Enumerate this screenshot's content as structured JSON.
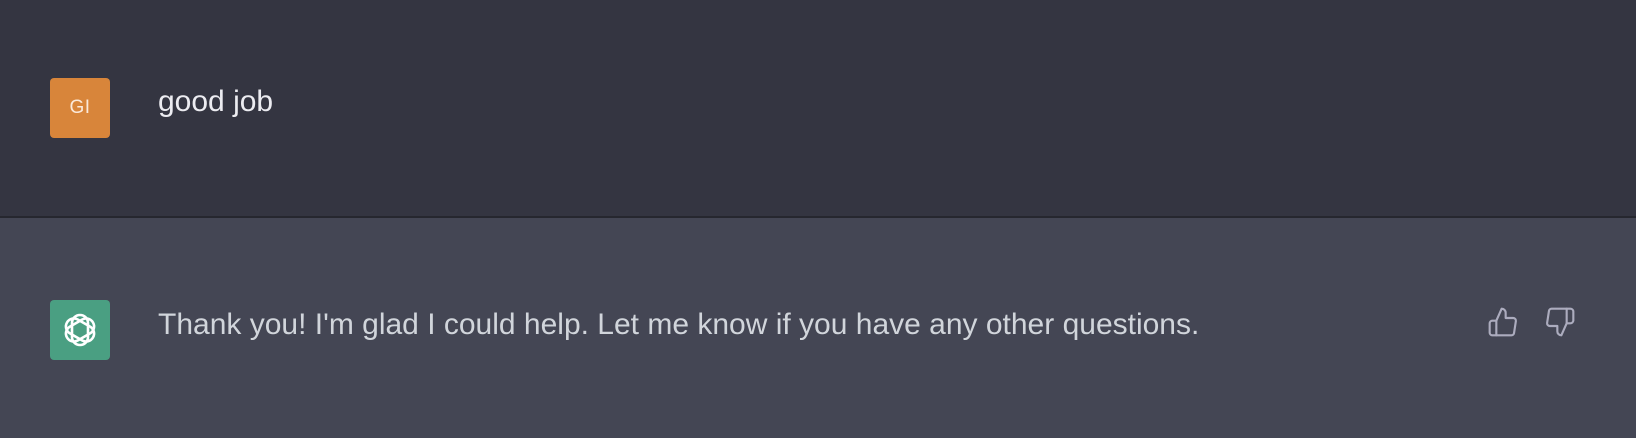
{
  "conversation": {
    "messages": [
      {
        "role": "user",
        "avatar_initials": "GI",
        "avatar_color": "#d8853a",
        "text": "good job"
      },
      {
        "role": "assistant",
        "avatar_icon": "openai-logo-icon",
        "avatar_color": "#4a9f82",
        "text": "Thank you! I'm glad I could help. Let me know if you have any other questions."
      }
    ],
    "feedback_icons": [
      "thumbs-up-icon",
      "thumbs-down-icon"
    ]
  },
  "colors": {
    "user_row_bg": "#343541",
    "assistant_row_bg": "#444654",
    "user_text": "#ececf1",
    "assistant_text": "#d1d5db",
    "icon_gray": "#acacbe"
  }
}
